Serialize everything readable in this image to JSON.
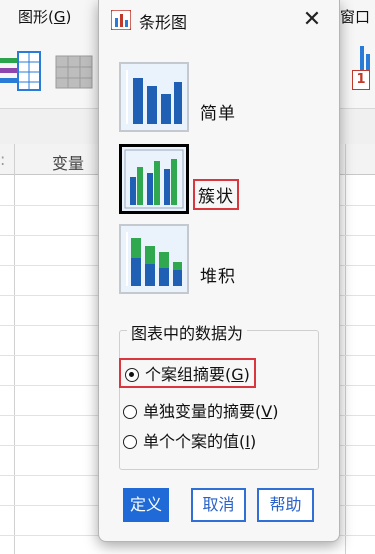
{
  "background": {
    "menu_graph": "图形(",
    "menu_graph_key": "G",
    "menu_graph_end": ")",
    "menu_window": "窗口",
    "col_header": "变量",
    "toolbar_badge": "1"
  },
  "dialog": {
    "title": "条形图",
    "close_symbol": "✕",
    "chart_types": [
      {
        "label": "简单"
      },
      {
        "label": "簇状"
      },
      {
        "label": "堆积"
      }
    ],
    "group_title": "图表中的数据为",
    "radio_options": [
      {
        "text": "个案组摘要(",
        "key": "G",
        "end": ")",
        "selected": true
      },
      {
        "text": "单独变量的摘要(",
        "key": "V",
        "end": ")",
        "selected": false
      },
      {
        "text": "单个个案的值(",
        "key": "I",
        "end": ")",
        "selected": false
      }
    ],
    "buttons": {
      "define": "定义",
      "cancel": "取消",
      "help": "帮助"
    },
    "accent_color": "#1f6ad6",
    "highlight_color": "#d9363e"
  }
}
